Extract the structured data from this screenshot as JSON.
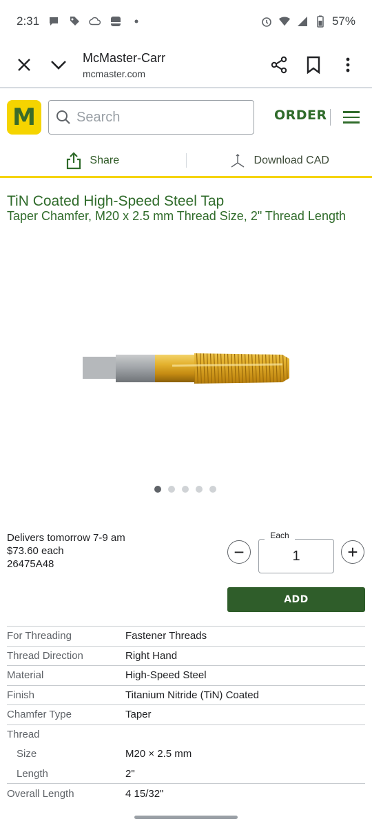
{
  "status": {
    "time": "2:31",
    "battery": "57%"
  },
  "browser": {
    "title": "McMaster-Carr",
    "url": "mcmaster.com"
  },
  "header": {
    "logo_letter": "M",
    "search_placeholder": "Search",
    "order_label": "ORDER",
    "accent": "#2f6b2a",
    "logo_color": "#f5d400"
  },
  "actions": {
    "share_label": "Share",
    "download_cad_label": "Download CAD"
  },
  "product": {
    "title": "TiN Coated High-Speed Steel Tap",
    "subtitle": "Taper Chamfer, M20 x 2.5 mm Thread Size, 2\" Thread Length",
    "image_count": 5,
    "active_image": 1
  },
  "purchase": {
    "delivery": "Delivers tomorrow 7-9 am",
    "price": "$73.60 each",
    "part_number": "26475A48",
    "qty_label": "Each",
    "qty_value": "1",
    "minus_symbol": "−",
    "plus_symbol": "+",
    "add_label": "ADD"
  },
  "specs": [
    {
      "label": "For Threading",
      "value": "Fastener Threads"
    },
    {
      "label": "Thread Direction",
      "value": "Right Hand"
    },
    {
      "label": "Material",
      "value": "High-Speed Steel"
    },
    {
      "label": "Finish",
      "value": "Titanium Nitride (TiN) Coated"
    },
    {
      "label": "Chamfer Type",
      "value": "Taper"
    },
    {
      "label": "Thread",
      "value": ""
    },
    {
      "label": "Size",
      "value": "M20 × 2.5 mm"
    },
    {
      "label": "Length",
      "value": "2\""
    },
    {
      "label": "Overall Length",
      "value": "4 15/32\""
    }
  ]
}
